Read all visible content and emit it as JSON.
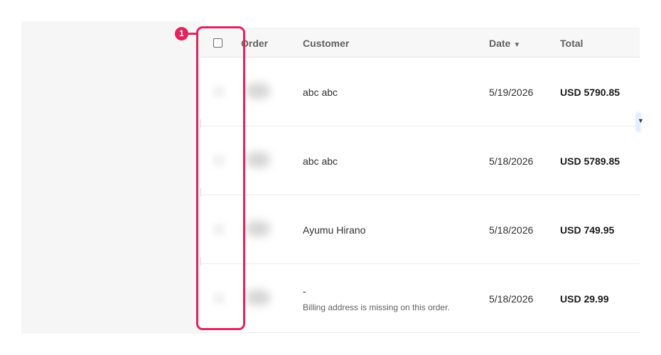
{
  "table": {
    "columns": {
      "order": "Order",
      "customer": "Customer",
      "date": "Date",
      "date_sort_icon": "caret-down-icon",
      "total": "Total"
    },
    "rows": [
      {
        "customer": "abc abc",
        "date": "5/19/2026",
        "total": "USD 5790.85",
        "note": ""
      },
      {
        "customer": "abc abc",
        "date": "5/18/2026",
        "total": "USD 5789.85",
        "note": ""
      },
      {
        "customer": "Ayumu Hirano",
        "date": "5/18/2026",
        "total": "USD 749.95",
        "note": ""
      },
      {
        "customer": "-",
        "date": "5/18/2026",
        "total": "USD 29.99",
        "note": "Billing address is missing on this order."
      }
    ]
  },
  "annotation": {
    "badge_number": "1",
    "color": "#e0245e"
  }
}
